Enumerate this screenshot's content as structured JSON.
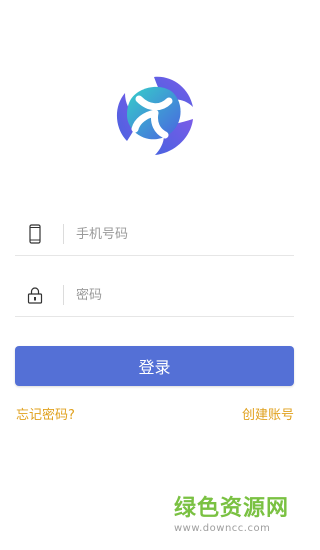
{
  "logo": {
    "icon": "tri-blade-logo"
  },
  "phone_field": {
    "icon": "phone-icon",
    "placeholder": "手机号码",
    "value": ""
  },
  "password_field": {
    "icon": "lock-icon",
    "placeholder": "密码",
    "value": ""
  },
  "login_button": {
    "label": "登录"
  },
  "links": {
    "forgot": "忘记密码?",
    "register": "创建账号"
  },
  "watermark": {
    "brand": "绿色资源网",
    "url": "www.downcc.com"
  },
  "colors": {
    "primary": "#5470d6",
    "link": "#e0a11e",
    "watermark": "#7ac142",
    "logo_teal": "#35cfc9",
    "logo_blue": "#4a63e0",
    "logo_purple": "#7a5be8"
  }
}
